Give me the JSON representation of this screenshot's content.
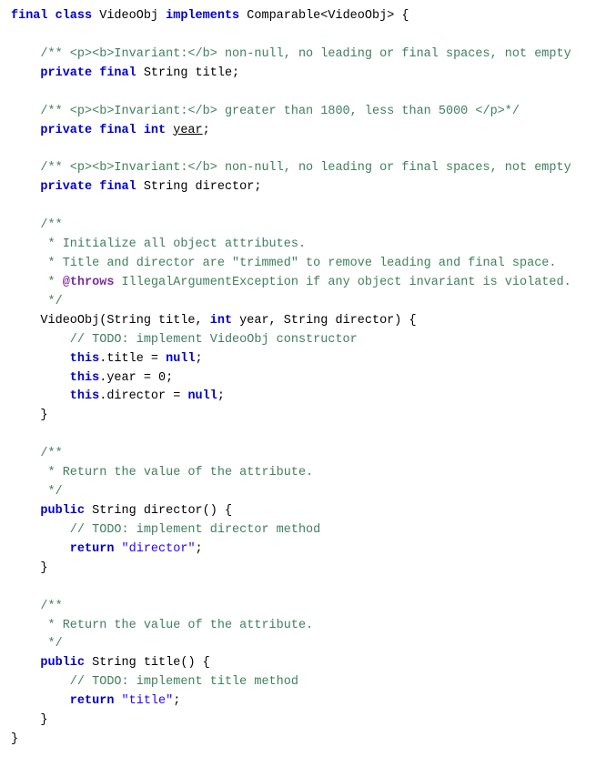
{
  "code": {
    "lines": [
      {
        "id": 1,
        "tokens": [
          {
            "t": "kw-blue",
            "v": "final class "
          },
          {
            "t": "normal",
            "v": "VideoObj "
          },
          {
            "t": "kw-blue",
            "v": "implements "
          },
          {
            "t": "normal",
            "v": "Comparable<VideoObj> {"
          }
        ]
      },
      {
        "id": 2,
        "tokens": []
      },
      {
        "id": 3,
        "tokens": [
          {
            "t": "comment",
            "v": "    /** <p><b>Invariant:</b> non-null, no leading or final spaces, not empty"
          }
        ]
      },
      {
        "id": 4,
        "tokens": [
          {
            "t": "kw-blue",
            "v": "    private final "
          },
          {
            "t": "normal",
            "v": "String title;"
          }
        ]
      },
      {
        "id": 5,
        "tokens": []
      },
      {
        "id": 6,
        "tokens": [
          {
            "t": "comment",
            "v": "    /** <p><b>Invariant:</b> greater than 1800, less than 5000 </p>*/"
          }
        ]
      },
      {
        "id": 7,
        "tokens": [
          {
            "t": "kw-blue",
            "v": "    private final int "
          },
          {
            "t": "underline",
            "v": "year"
          },
          {
            "t": "normal",
            "v": ";"
          }
        ]
      },
      {
        "id": 8,
        "tokens": []
      },
      {
        "id": 9,
        "tokens": [
          {
            "t": "comment",
            "v": "    /** <p><b>Invariant:</b> non-null, no leading or final spaces, not empty"
          }
        ]
      },
      {
        "id": 10,
        "tokens": [
          {
            "t": "kw-blue",
            "v": "    private final "
          },
          {
            "t": "normal",
            "v": "String director;"
          }
        ]
      },
      {
        "id": 11,
        "tokens": []
      },
      {
        "id": 12,
        "tokens": [
          {
            "t": "comment",
            "v": "    /**"
          }
        ]
      },
      {
        "id": 13,
        "tokens": [
          {
            "t": "comment",
            "v": "     * Initialize all object attributes."
          }
        ]
      },
      {
        "id": 14,
        "tokens": [
          {
            "t": "comment",
            "v": "     * Title and director are \"trimmed\" to remove leading and final space."
          }
        ]
      },
      {
        "id": 15,
        "tokens": [
          {
            "t": "comment",
            "v": "     * "
          },
          {
            "t": "comment-tag",
            "v": "@throws "
          },
          {
            "t": "comment",
            "v": "IllegalArgumentException if any object invariant is violated."
          }
        ]
      },
      {
        "id": 16,
        "tokens": [
          {
            "t": "comment",
            "v": "     */"
          }
        ]
      },
      {
        "id": 17,
        "tokens": [
          {
            "t": "normal",
            "v": "    VideoObj(String title, "
          },
          {
            "t": "kw-blue",
            "v": "int "
          },
          {
            "t": "normal",
            "v": "year, String director) {"
          }
        ]
      },
      {
        "id": 18,
        "tokens": [
          {
            "t": "todo",
            "v": "        // TODO: implement VideoObj constructor"
          }
        ]
      },
      {
        "id": 19,
        "tokens": [
          {
            "t": "kw-blue",
            "v": "        this"
          },
          {
            "t": "normal",
            "v": ".title = "
          },
          {
            "t": "kw-blue",
            "v": "null"
          },
          {
            "t": "normal",
            "v": ";"
          }
        ]
      },
      {
        "id": 20,
        "tokens": [
          {
            "t": "kw-blue",
            "v": "        this"
          },
          {
            "t": "normal",
            "v": ".year = "
          },
          {
            "t": "number",
            "v": "0"
          },
          {
            "t": "normal",
            "v": ";"
          }
        ]
      },
      {
        "id": 21,
        "tokens": [
          {
            "t": "kw-blue",
            "v": "        this"
          },
          {
            "t": "normal",
            "v": ".director = "
          },
          {
            "t": "kw-blue",
            "v": "null"
          },
          {
            "t": "normal",
            "v": ";"
          }
        ]
      },
      {
        "id": 22,
        "tokens": [
          {
            "t": "normal",
            "v": "    }"
          }
        ]
      },
      {
        "id": 23,
        "tokens": []
      },
      {
        "id": 24,
        "tokens": [
          {
            "t": "comment",
            "v": "    /**"
          }
        ]
      },
      {
        "id": 25,
        "tokens": [
          {
            "t": "comment",
            "v": "     * Return the value of the attribute."
          }
        ]
      },
      {
        "id": 26,
        "tokens": [
          {
            "t": "comment",
            "v": "     */"
          }
        ]
      },
      {
        "id": 27,
        "tokens": [
          {
            "t": "kw-blue",
            "v": "    public "
          },
          {
            "t": "normal",
            "v": "String director() {"
          }
        ]
      },
      {
        "id": 28,
        "tokens": [
          {
            "t": "todo",
            "v": "        // TODO: implement director method"
          }
        ]
      },
      {
        "id": 29,
        "tokens": [
          {
            "t": "kw-blue",
            "v": "        return "
          },
          {
            "t": "string",
            "v": "\"director\""
          },
          {
            "t": "normal",
            "v": ";"
          }
        ]
      },
      {
        "id": 30,
        "tokens": [
          {
            "t": "normal",
            "v": "    }"
          }
        ]
      },
      {
        "id": 31,
        "tokens": []
      },
      {
        "id": 32,
        "tokens": [
          {
            "t": "comment",
            "v": "    /**"
          }
        ]
      },
      {
        "id": 33,
        "tokens": [
          {
            "t": "comment",
            "v": "     * Return the value of the attribute."
          }
        ]
      },
      {
        "id": 34,
        "tokens": [
          {
            "t": "comment",
            "v": "     */"
          }
        ]
      },
      {
        "id": 35,
        "tokens": [
          {
            "t": "kw-blue",
            "v": "    public "
          },
          {
            "t": "normal",
            "v": "String title() {"
          }
        ]
      },
      {
        "id": 36,
        "tokens": [
          {
            "t": "todo",
            "v": "        // TODO: implement title method"
          }
        ]
      },
      {
        "id": 37,
        "tokens": [
          {
            "t": "kw-blue",
            "v": "        return "
          },
          {
            "t": "string",
            "v": "\"title\""
          },
          {
            "t": "normal",
            "v": ";"
          }
        ]
      },
      {
        "id": 38,
        "tokens": [
          {
            "t": "normal",
            "v": "    }"
          }
        ]
      },
      {
        "id": 39,
        "tokens": [
          {
            "t": "normal",
            "v": "}"
          }
        ]
      }
    ]
  }
}
